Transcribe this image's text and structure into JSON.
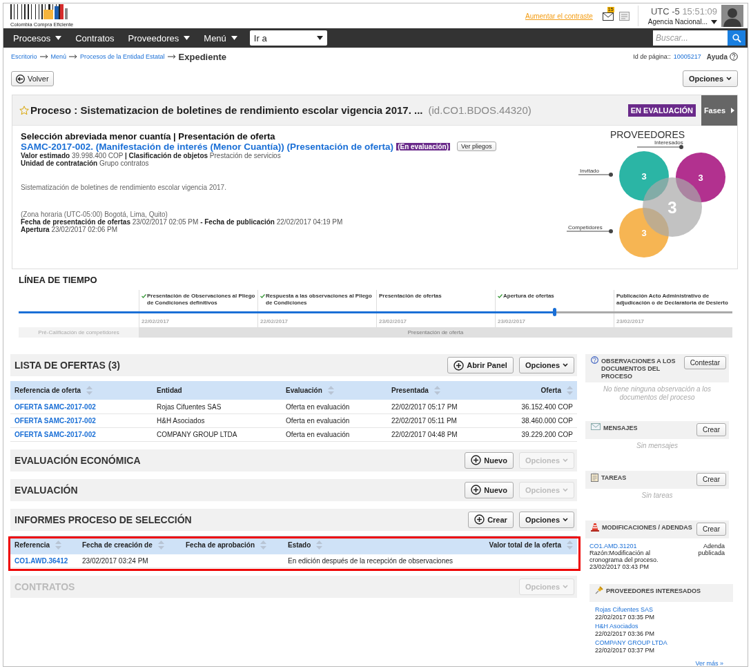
{
  "header": {
    "logo_text": "Colombia Compra Eficiente",
    "contrast_link": "Aumentar el contraste",
    "mail_count": "15",
    "timezone": "UTC -5",
    "time": "15:51:09",
    "account": "Agencia Nacional..."
  },
  "nav": {
    "menus": [
      {
        "label": "Procesos",
        "dropdown": true
      },
      {
        "label": "Contratos",
        "dropdown": false
      },
      {
        "label": "Proveedores",
        "dropdown": true
      },
      {
        "label": "Menú",
        "dropdown": true
      }
    ],
    "goto": {
      "value": "Ir a"
    },
    "search": {
      "placeholder": "Buscar..."
    }
  },
  "breadcrumb": {
    "items": [
      "Escritorio",
      "Menú",
      "Procesos de la Entidad Estatal"
    ],
    "current": "Expediente",
    "page_id_label": "Id de página::",
    "page_id": "10005217",
    "help": "Ayuda"
  },
  "toolbar": {
    "back": "Volver",
    "options": "Opciones"
  },
  "process": {
    "favorite": false,
    "title": "Proceso : Sistematizacion de boletines de rendimiento escolar vigencia 2017. ...",
    "id": "(id.CO1.BDOS.44320)",
    "status": "EN EVALUACIÓN",
    "phases_button": "Fases",
    "subtitle": "Selección abreviada menor cuantía | Presentación de oferta",
    "reference": "SAMC-2017-002. (Manifestación de interés (Menor Cuantía)) (Presentación de oferta)",
    "reference_badge": "(En evaluación)",
    "docs_button": "Ver pliegos",
    "facts": [
      "**Valor estimado** 39.998.400 COP **| Clasificación de objetos**   Prestación de servicios",
      "**Unidad de contratación** Grupo contratos"
    ],
    "description": "Sistematización de boletines de rendimiento escolar vigencia 2017.",
    "dates": [
      "(Zona horaria (UTC-05:00) Bogotá, Lima, Quito)",
      "**Fecha de presentación de ofertas** 23/02/2017 02:05 PM **- Fecha de publicación** 22/02/2017 04:19 PM",
      "**Apertura** 23/02/2017 02:06 PM"
    ]
  },
  "providers": {
    "title": "PROVEEDORES",
    "total": "3",
    "groups": [
      {
        "label": "Invitado",
        "value": "3",
        "color": "#2bb5a5"
      },
      {
        "label": "Interesados",
        "value": "3",
        "color": "#b2318f"
      },
      {
        "label": "Competidores",
        "value": "3",
        "color": "#f6b553"
      }
    ]
  },
  "timeline": {
    "title": "LÍNEA DE TIEMPO",
    "level": 0.75,
    "milestones": [
      {
        "label": "Presentación de Observaciones al Pliego de Condiciones definitivos",
        "done": true,
        "date": "22/02/2017"
      },
      {
        "label": "Respuesta a las observaciones al Pliego de Condiciones",
        "done": true,
        "date": "22/02/2017"
      },
      {
        "label": "Presentación de ofertas",
        "done": false,
        "date": "23/02/2017"
      },
      {
        "label": "Apertura de ofertas",
        "done": true,
        "date": "23/02/2017"
      },
      {
        "label": "Publicación Acto Administrativo de adjudicación o de Declaratoria de Desierto",
        "done": false,
        "date": "23/02/2017"
      }
    ],
    "phases": [
      {
        "label": "Pré-Calificación de competidores",
        "selected": false
      },
      {
        "label": "Presentación de oferta",
        "selected": true
      }
    ]
  },
  "sections": [
    {
      "title": "LISTA DE OFERTAS (3)",
      "disabled": false,
      "highlighted": false,
      "actions": [
        {
          "label": "Abrir Panel"
        }
      ],
      "options": {
        "label": "Opciones",
        "disabled": false
      },
      "table": {
        "columns": [
          {
            "label": "Referencia de oferta",
            "sortable": true
          },
          {
            "label": "Entidad",
            "sortable": false
          },
          {
            "label": "Evaluación",
            "sortable": true
          },
          {
            "label": "Presentada",
            "sortable": true
          },
          {
            "label": "Oferta",
            "sortable": true
          }
        ],
        "rows": [
          [
            "OFERTA SAMC-2017-002",
            "Rojas Cifuentes SAS",
            "Oferta en evaluación",
            "22/02/2017 05:17 PM",
            "36.152.400 COP"
          ],
          [
            "OFERTA SAMC-2017-002",
            "H&H Asociados",
            "Oferta en evaluación",
            "22/02/2017 05:11 PM",
            "38.460.000 COP"
          ],
          [
            "OFERTA SAMC-2017-002",
            "COMPANY GROUP LTDA",
            "Oferta en evaluación",
            "22/02/2017 04:48 PM",
            "39.229.200 COP"
          ]
        ]
      }
    },
    {
      "title": "EVALUACIÓN ECONÓMICA",
      "disabled": false,
      "highlighted": false,
      "actions": [
        {
          "label": "Nuevo"
        }
      ],
      "options": {
        "label": "Opciones",
        "disabled": true
      }
    },
    {
      "title": "EVALUACIÓN",
      "disabled": false,
      "highlighted": false,
      "actions": [
        {
          "label": "Nuevo"
        }
      ],
      "options": {
        "label": "Opciones",
        "disabled": true
      }
    },
    {
      "title": "INFORMES PROCESO DE SELECCIÓN",
      "disabled": false,
      "highlighted": true,
      "actions": [
        {
          "label": "Crear"
        }
      ],
      "options": {
        "label": "Opciones",
        "disabled": false
      },
      "table": {
        "columns": [
          {
            "label": "Referencia",
            "sortable": true
          },
          {
            "label": "Fecha de creación de",
            "sortable": true
          },
          {
            "label": "Fecha de aprobación",
            "sortable": true
          },
          {
            "label": "Estado",
            "sortable": true
          },
          {
            "label": "Valor total de la oferta",
            "sortable": true
          }
        ],
        "rows": [
          [
            "CO1.AWD.36412",
            "23/02/2017 03:24 PM",
            "",
            "En edición después de la recepción de observaciones",
            ""
          ]
        ]
      }
    },
    {
      "title": "CONTRATOS",
      "disabled": true,
      "highlighted": false,
      "options": {
        "label": "Opciones",
        "disabled": true
      }
    }
  ],
  "sidebar": [
    {
      "kind": "question",
      "title": "OBSERVACIONES A LOS DOCUMENTOS DEL PROCESO",
      "button": "Contestar",
      "empty": "No tiene ninguna observación a los documentos del proceso"
    },
    {
      "kind": "mail",
      "title": "MENSAJES",
      "button": "Crear",
      "empty": "Sin mensajes"
    },
    {
      "kind": "clipboard",
      "title": "TAREAS",
      "button": "Crear",
      "empty": "Sin tareas"
    },
    {
      "kind": "cone",
      "title": "MODIFICACIONES / ADENDAS",
      "button": "Crear",
      "amendments": [
        {
          "ref": "CO1.AMD.31201",
          "reason": "Razón:Modificación al cronograma del proceso.",
          "date": "23/02/2017 03:43 PM",
          "status": "Adenda publicada"
        }
      ]
    },
    {
      "kind": "pin",
      "title": "PROVEEDORES INTERESADOS",
      "suppliers": [
        {
          "name": "Rojas Cifuentes SAS",
          "date": "22/02/2017 03:35 PM"
        },
        {
          "name": "H&H Asociados",
          "date": "22/02/2017 03:36 PM"
        },
        {
          "name": "COMPANY GROUP LTDA",
          "date": "22/02/2017 03:37 PM"
        }
      ],
      "more": "Ver más »"
    }
  ]
}
